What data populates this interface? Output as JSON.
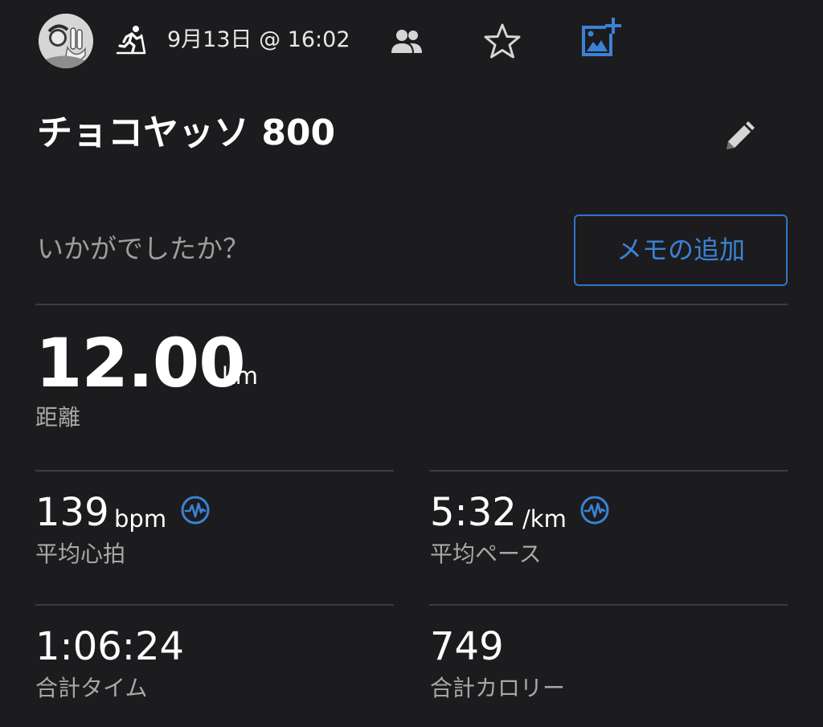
{
  "header": {
    "avatar_icon": "user-avatar-icon",
    "activity_icon": "treadmill-run-icon",
    "datetime": "9月13日 @ 16:02",
    "people_icon": "people-icon",
    "star_icon": "star-outline-icon",
    "photo_add_icon": "add-photo-icon",
    "accent_color": "#3b82d6"
  },
  "activity": {
    "title": "チョコヤッソ 800",
    "edit_icon": "pencil-icon"
  },
  "memo": {
    "prompt": "いかがでしたか？",
    "add_button_label": "メモの追加"
  },
  "stats": {
    "distance": {
      "value": "12.00",
      "unit": "km",
      "label": "距離"
    },
    "avg_heart_rate": {
      "value": "139",
      "unit": "bpm",
      "label": "平均心拍",
      "icon": "pulse-icon"
    },
    "avg_pace": {
      "value": "5:32",
      "unit": "/km",
      "label": "平均ペース",
      "icon": "pulse-icon"
    },
    "total_time": {
      "value": "1:06:24",
      "label": "合計タイム"
    },
    "total_calories": {
      "value": "749",
      "label": "合計カロリー"
    }
  }
}
